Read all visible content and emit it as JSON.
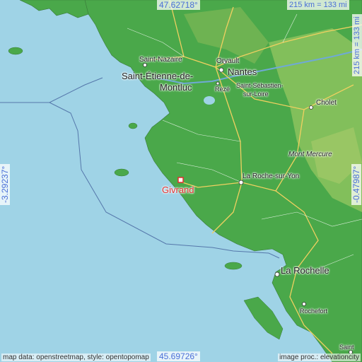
{
  "map": {
    "coords": {
      "top_lat": "47.62718°",
      "bottom_lat": "45.69726°",
      "left_lon": "-3.29237°",
      "right_lon": "-0.47987°"
    },
    "scale": {
      "horizontal": "215 km = 133 mi",
      "vertical": "215 km = 133 mi"
    },
    "places": {
      "saint_nazaire": "Saint-Nazaire",
      "orvault": "Orvault",
      "nantes": "Nantes",
      "saint_etienne": "Saint-Étienne-de-",
      "montluc": "Montluc",
      "reze": "Rezé",
      "saint_sebastien": "Saint-Sébastien-",
      "sur_loire": "sur-Loire",
      "cholet": "Cholet",
      "mont_mercure": "Mont Mercure",
      "la_roche_sur_yon": "La Roche-sur-Yon",
      "givrand": "Givrand",
      "la_rochelle": "La Rochelle",
      "rochefort": "Rochefort",
      "saintes": "Saint"
    },
    "credits": {
      "left": "map data: openstreetmap, style: opentopomap",
      "right": "image proc.: elevationcity"
    },
    "colors": {
      "sea": "#9fd3e6",
      "lowland": "#4aa84a",
      "highland": "#7fbf5a",
      "marker": "#e03030",
      "coord_text": "#4a6fd8"
    }
  }
}
